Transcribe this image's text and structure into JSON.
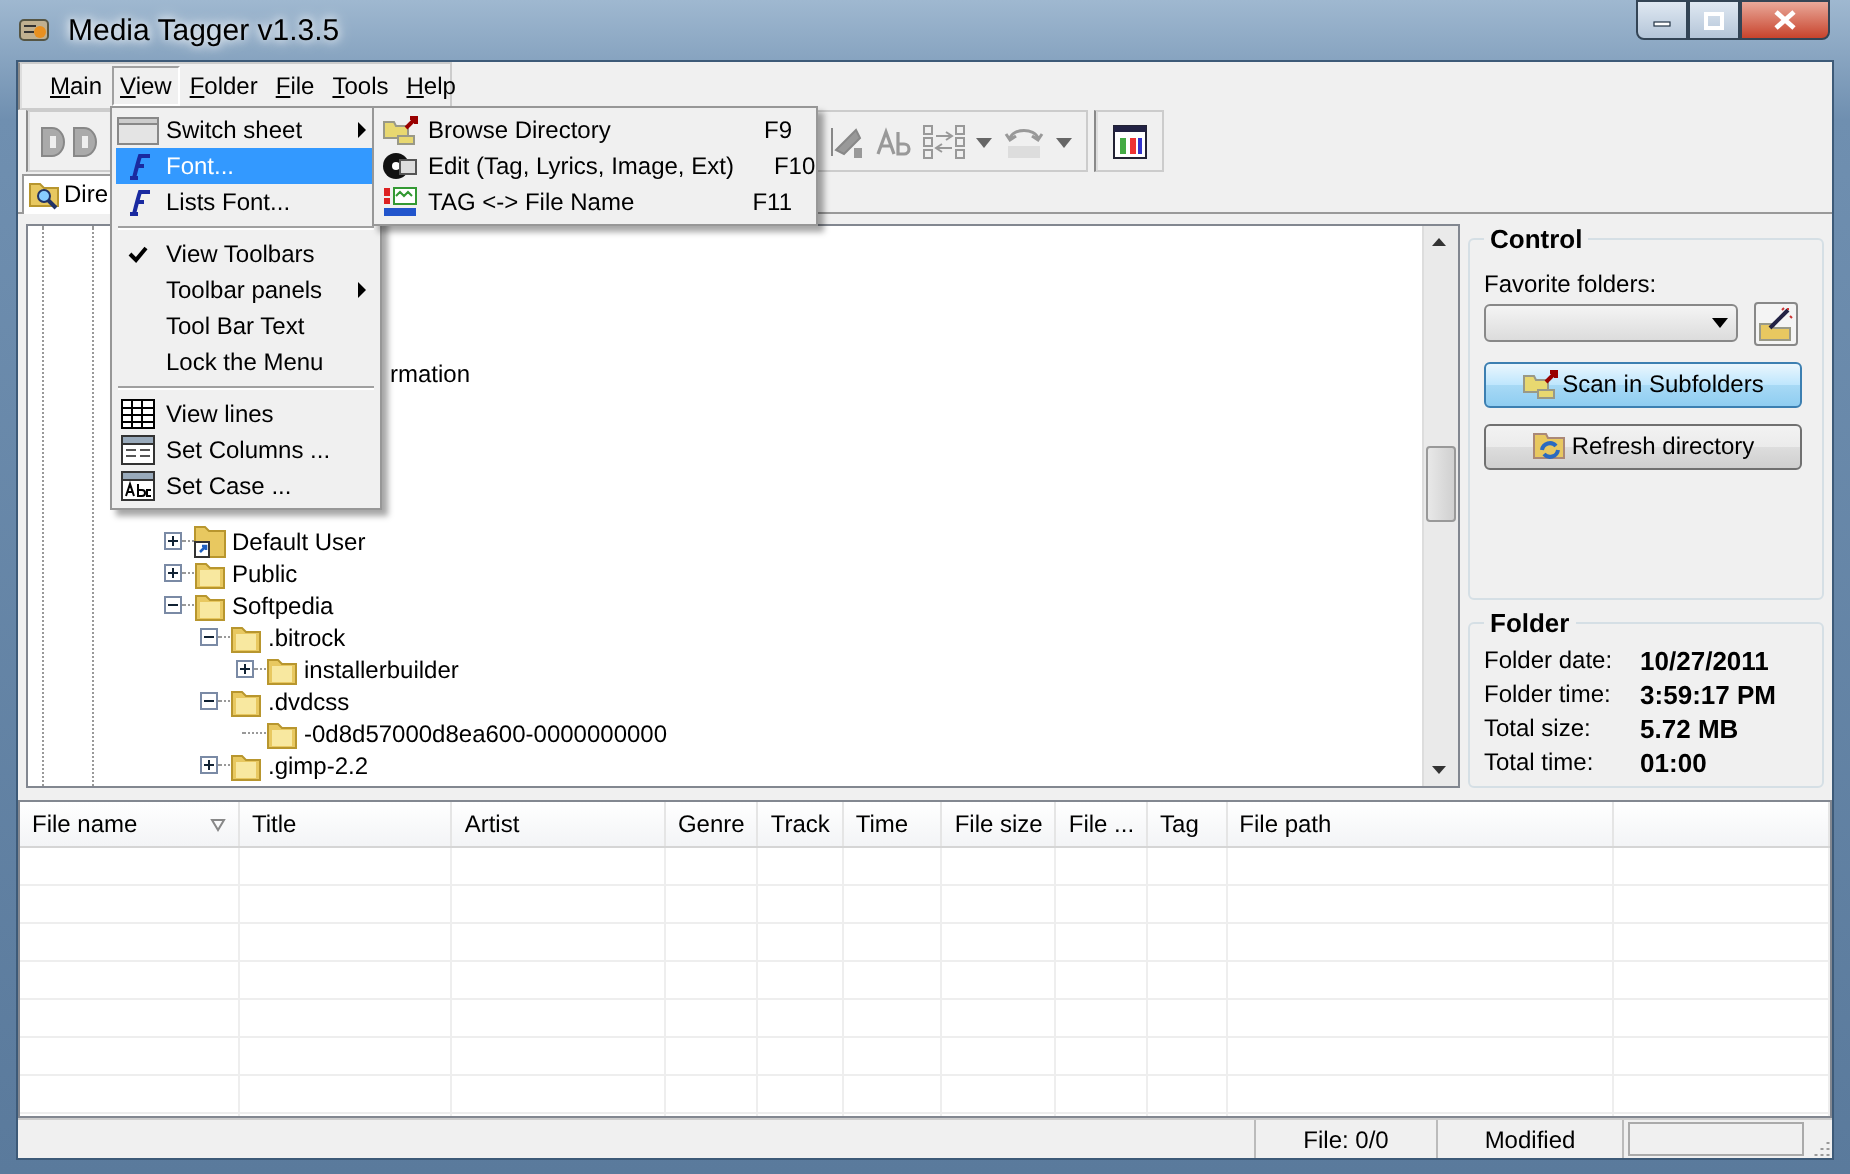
{
  "window": {
    "title": "Media Tagger v1.3.5"
  },
  "menu_bar": [
    {
      "label": "Main",
      "selected": false
    },
    {
      "label": "View",
      "selected": true
    },
    {
      "label": "Folder",
      "selected": false
    },
    {
      "label": "File",
      "selected": false
    },
    {
      "label": "Tools",
      "selected": false
    },
    {
      "label": "Help",
      "selected": false
    }
  ],
  "view_menu": {
    "items": [
      {
        "kind": "item",
        "label": "Switch sheet",
        "submenu": true,
        "checked": false,
        "selected": false
      },
      {
        "kind": "item",
        "label": "Font...",
        "submenu": false,
        "checked": false,
        "selected": true
      },
      {
        "kind": "item",
        "label": "Lists Font...",
        "submenu": false,
        "checked": false,
        "selected": false
      },
      {
        "kind": "separator"
      },
      {
        "kind": "item",
        "label": "View Toolbars",
        "submenu": false,
        "checked": true,
        "selected": false
      },
      {
        "kind": "item",
        "label": "Toolbar panels",
        "submenu": true,
        "checked": false,
        "selected": false
      },
      {
        "kind": "item",
        "label": "Tool Bar Text",
        "submenu": false,
        "checked": false,
        "selected": false
      },
      {
        "kind": "item",
        "label": "Lock the Menu",
        "submenu": false,
        "checked": false,
        "selected": false
      },
      {
        "kind": "separator"
      },
      {
        "kind": "item",
        "label": "View lines",
        "submenu": false,
        "checked": false,
        "selected": false
      },
      {
        "kind": "item",
        "label": "Set Columns ...",
        "submenu": false,
        "checked": false,
        "selected": false
      },
      {
        "kind": "item",
        "label": "Set Case ...",
        "submenu": false,
        "checked": false,
        "selected": false
      }
    ]
  },
  "switch_sheet_submenu": {
    "items": [
      {
        "label": "Browse Directory",
        "shortcut": "F9"
      },
      {
        "label": "Edit (Tag, Lyrics, Image, Ext)",
        "shortcut": "F10"
      },
      {
        "label": "TAG <-> File Name",
        "shortcut": "F11"
      }
    ]
  },
  "tab": {
    "label": "Dire",
    "selected": true
  },
  "tree": {
    "items": [
      {
        "kind": "cut",
        "label": "rmation"
      },
      {
        "kind": "shortcut",
        "label": "Default User",
        "expanded": false
      },
      {
        "kind": "folder",
        "label": "Public",
        "expanded": false
      },
      {
        "kind": "folder",
        "label": "Softpedia",
        "expanded": true,
        "children": [
          {
            "kind": "folder",
            "label": ".bitrock",
            "expanded": true,
            "children": [
              {
                "kind": "folder",
                "label": "installerbuilder",
                "expanded": false
              }
            ]
          },
          {
            "kind": "folder",
            "label": ".dvdcss",
            "expanded": true,
            "children": [
              {
                "kind": "folder",
                "label": "-0d8d57000d8ea600-0000000000"
              }
            ]
          },
          {
            "kind": "folder",
            "label": ".gimp-2.2",
            "expanded": false
          }
        ]
      }
    ]
  },
  "control": {
    "title": "Control",
    "favorite_label": "Favorite folders:",
    "buttons": [
      {
        "label": "Scan in Subfolders",
        "selected": true
      },
      {
        "label": "Refresh directory",
        "selected": false
      }
    ]
  },
  "folder": {
    "title": "Folder",
    "rows": [
      {
        "label": "Folder date:",
        "value": "10/27/2011"
      },
      {
        "label": "Folder time:",
        "value": "3:59:17 PM"
      },
      {
        "label": "Total size:",
        "value": "5.72 MB"
      },
      {
        "label": "Total time:",
        "value": "01:00"
      }
    ]
  },
  "file_list": {
    "columns": [
      {
        "label": "File name",
        "sorted": true
      },
      {
        "label": "Title",
        "sorted": false
      },
      {
        "label": "Artist",
        "sorted": false
      },
      {
        "label": "Genre",
        "sorted": false
      },
      {
        "label": "Track",
        "sorted": false
      },
      {
        "label": "Time",
        "sorted": false
      },
      {
        "label": "File size",
        "sorted": false
      },
      {
        "label": "File ...",
        "sorted": false
      },
      {
        "label": "Tag",
        "sorted": false
      },
      {
        "label": "File path",
        "sorted": false
      }
    ]
  },
  "status_bar": {
    "file_count": "File: 0/0",
    "state": "Modified"
  }
}
